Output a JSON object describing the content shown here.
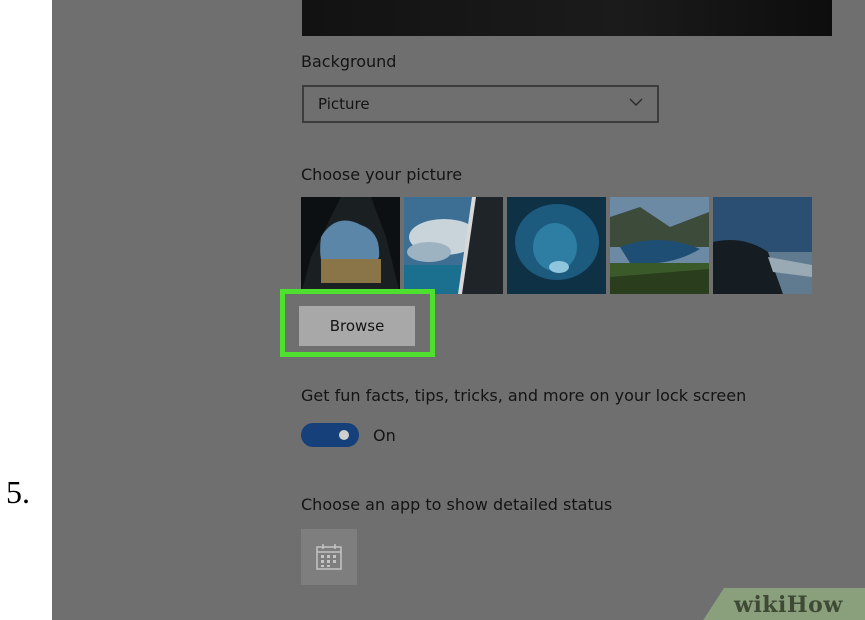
{
  "step": {
    "number": "5."
  },
  "settings": {
    "background": {
      "label": "Background",
      "dropdown_value": "Picture",
      "dropdown_icon": "chevron-down-icon"
    },
    "picture": {
      "label": "Choose your picture",
      "thumbnails": [
        {
          "name": "cave-beach-thumbnail"
        },
        {
          "name": "sky-window-thumbnail"
        },
        {
          "name": "blue-water-thumbnail"
        },
        {
          "name": "lake-mountains-thumbnail"
        },
        {
          "name": "hillside-sky-thumbnail"
        }
      ],
      "browse_label": "Browse"
    },
    "lock_screen_tips": {
      "label": "Get fun facts, tips, tricks, and more on your lock screen",
      "toggle_state": "On",
      "toggle_on": true
    },
    "detailed_status": {
      "label": "Choose an app to show detailed status",
      "app_icon": "calendar-icon"
    }
  },
  "colors": {
    "highlight": "#4fe02f",
    "toggle_on": "#15407a",
    "panel_background": "#6f6f6f"
  },
  "watermark": {
    "text": "wikiHow"
  }
}
